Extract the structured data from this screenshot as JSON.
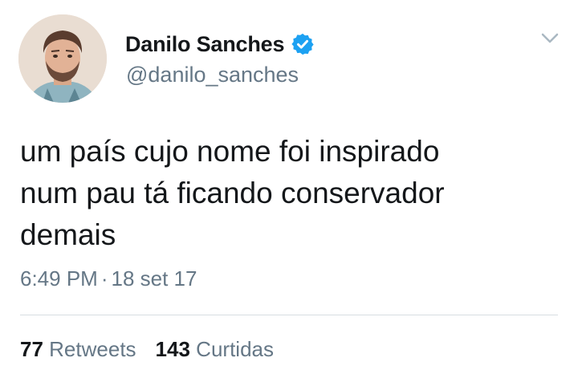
{
  "author": {
    "display_name": "Danilo Sanches",
    "handle": "@danilo_sanches",
    "verified": true,
    "avatar_icon": "profile-photo",
    "verified_icon": "verified-badge-icon"
  },
  "menu_icon": "chevron-down-icon",
  "tweet": {
    "lines": [
      "um país cujo nome foi inspirado",
      "num pau tá ficando conservador",
      "demais"
    ]
  },
  "meta": {
    "time": "6:49 PM",
    "separator": "·",
    "date": "18 set 17"
  },
  "stats": {
    "retweets_count": "77",
    "retweets_label": "Retweets",
    "likes_count": "143",
    "likes_label": "Curtidas"
  },
  "colors": {
    "text": "#14171a",
    "secondary": "#657786",
    "verified": "#1da1f2",
    "divider": "#d8dee2"
  }
}
